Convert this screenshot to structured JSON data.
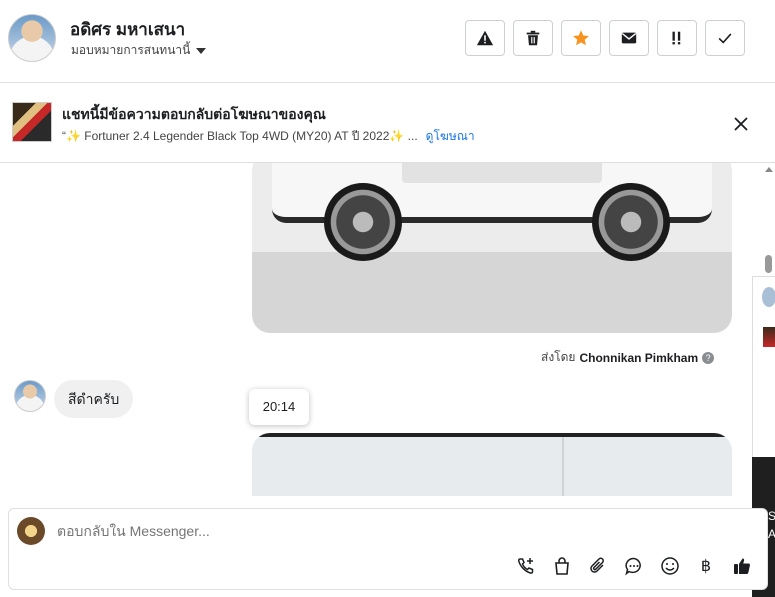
{
  "contact": {
    "name": "อดิศร มหาเสนา",
    "assign_label": "มอบหมายการสนทนานี้"
  },
  "header_actions": [
    {
      "icon": "warning-icon"
    },
    {
      "icon": "trash-icon"
    },
    {
      "icon": "star-icon",
      "color": "#f7931e"
    },
    {
      "icon": "mail-icon"
    },
    {
      "icon": "important-icon",
      "text": "!!"
    },
    {
      "icon": "check-icon"
    }
  ],
  "ad_banner": {
    "title": "แชทนี้มีข้อความตอบกลับต่อโฆษณาของคุณ",
    "subtitle": "“✨ Fortuner 2.4 Legender Black Top 4WD (MY20) AT ปี 2022✨ ...",
    "link": "ดูโฆษณา"
  },
  "messages": {
    "sent_by_prefix": "ส่งโดย",
    "sent_by_name": "Chonnikan Pimkham",
    "incoming_text": "สีดำครับ",
    "timestamp_tooltip": "20:14"
  },
  "side_panel": {
    "letters": [
      "S",
      "A"
    ]
  },
  "composer": {
    "placeholder": "ตอบกลับใน Messenger...",
    "tools": [
      {
        "icon": "call-add-icon"
      },
      {
        "icon": "shopping-bag-icon"
      },
      {
        "icon": "attachment-icon"
      },
      {
        "icon": "chat-bubble-icon"
      },
      {
        "icon": "emoji-icon"
      },
      {
        "icon": "baht-icon",
        "text": "฿"
      },
      {
        "icon": "thumbs-up-icon"
      }
    ]
  },
  "colors": {
    "accent_blue": "#1b74e4",
    "star_orange": "#f7931e",
    "border": "#dddfe2"
  }
}
